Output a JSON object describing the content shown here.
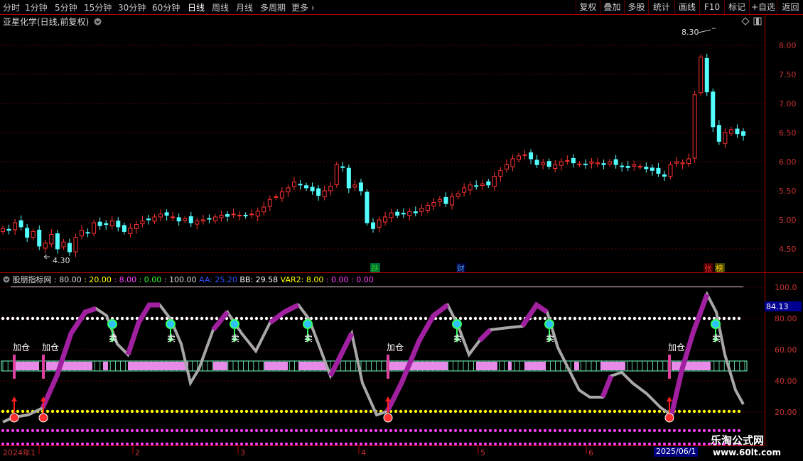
{
  "toolbar": {
    "periods": [
      "分时",
      "1分钟",
      "5分钟",
      "15分钟",
      "30分钟",
      "60分钟",
      "日线",
      "周线",
      "月线",
      "多周期",
      "更多"
    ],
    "active": "日线",
    "right": [
      "复权",
      "叠加",
      "多股",
      "统计",
      "画线",
      "F10",
      "标记",
      "+自选",
      "返回"
    ]
  },
  "title": "亚星化学(日线,前复权)",
  "price_axis": [
    "8.00",
    "7.50",
    "7.00",
    "6.50",
    "6.00",
    "5.50",
    "5.00",
    "4.50"
  ],
  "high_label": "8.30",
  "low_label": "4.30",
  "badges": [
    {
      "text": "跌",
      "color": "#22cc22"
    },
    {
      "text": "财",
      "color": "#4aa0ff"
    },
    {
      "text": "张",
      "color": "#ff3030"
    },
    {
      "text": "榜",
      "color": "#ffcc00"
    }
  ],
  "indicator": {
    "name": "股朋指标网",
    "values": [
      {
        "t": ": 80.00",
        "c": "#d8d8d8"
      },
      {
        "t": ": 20.00",
        "c": "#ffff00"
      },
      {
        "t": ": 8.00",
        "c": "#ff40ff"
      },
      {
        "t": ": 0.00",
        "c": "#30ff30"
      },
      {
        "t": ": 100.00",
        "c": "#d8d8d8"
      },
      {
        "t": "AA: 25.20",
        "c": "#3050ff"
      },
      {
        "t": "BB: 29.58",
        "c": "#ffffff"
      },
      {
        "t": "VAR2: 8.00",
        "c": "#ffff00"
      },
      {
        "t": ": 0.00",
        "c": "#ff40ff"
      },
      {
        "t": ": 0.00",
        "c": "#ff40ff"
      }
    ],
    "axis": [
      "100.0",
      "80.00",
      "60.00",
      "40.00",
      "20.00"
    ],
    "current_value": "84.13",
    "add_label": "加仓",
    "sell_label": "卖"
  },
  "time_axis": [
    "2024年1",
    "2",
    "3",
    "4",
    "5",
    "6"
  ],
  "date_badge": "2025/06/1",
  "watermark": {
    "title": "乐淘公式网",
    "url": "www.60lt.com"
  },
  "colors": {
    "up": "#ff3232",
    "down": "#54ffff",
    "frame": "#b40000"
  }
}
